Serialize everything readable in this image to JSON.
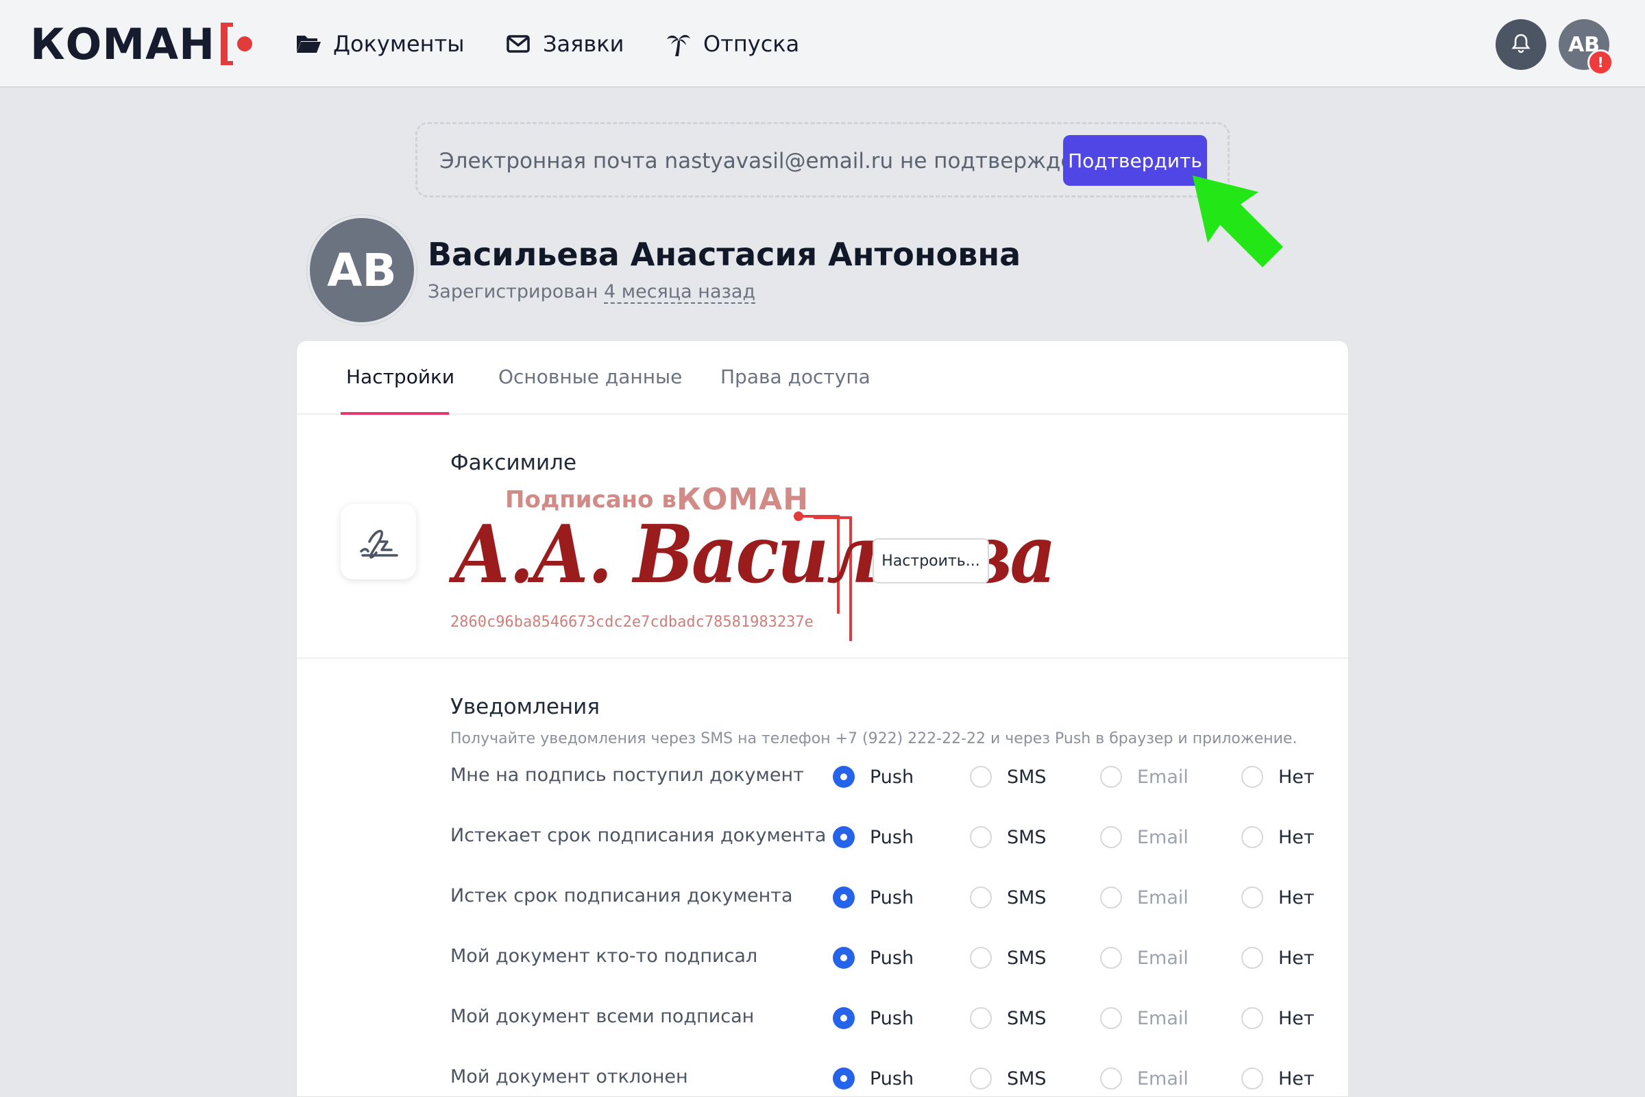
{
  "header": {
    "logo": "КОМАН",
    "nav": [
      {
        "label": "Документы",
        "icon": "folder-open-icon"
      },
      {
        "label": "Заявки",
        "icon": "envelope-icon"
      },
      {
        "label": "Отпуска",
        "icon": "palm-tree-icon"
      }
    ],
    "user_initials": "АВ",
    "alert_badge": "!"
  },
  "email_notice": {
    "text": "Электронная почта nastyavasil@email.ru не подтверждена",
    "confirm_label": "Подтвердить"
  },
  "profile": {
    "initials": "АВ",
    "name": "Васильева Анастасия Антоновна",
    "registered_prefix": "Зарегистрирован",
    "registered_ago": "4 месяца назад"
  },
  "tabs": [
    {
      "label": "Настройки",
      "active": true
    },
    {
      "label": "Основные данные",
      "active": false
    },
    {
      "label": "Права доступа",
      "active": false
    }
  ],
  "facsimile": {
    "title": "Факсимиле",
    "caption": "Подписано в",
    "brand": "КОМАН",
    "signature": "А.А. Васильева",
    "hash": "2860c96ba8546673cdc2e7cdbadc78581983237e",
    "configure_label": "Настроить..."
  },
  "notifications": {
    "title": "Уведомления",
    "description": "Получайте уведомления через SMS на телефон +7 (922) 222-22-22 и через Push в браузер и приложение.",
    "options": [
      "Push",
      "SMS",
      "Email",
      "Нет"
    ],
    "rows": [
      {
        "label": "Мне на подпись поступил документ",
        "selected": "Push"
      },
      {
        "label": "Истекает срок подписания документа",
        "selected": "Push"
      },
      {
        "label": "Истек срок подписания документа",
        "selected": "Push"
      },
      {
        "label": "Мой документ кто-то подписал",
        "selected": "Push"
      },
      {
        "label": "Мой документ всеми подписан",
        "selected": "Push"
      },
      {
        "label": "Мой документ отклонен",
        "selected": "Push"
      }
    ]
  },
  "colors": {
    "accent": "#4f46e5",
    "radio_selected": "#2563eb",
    "tab_underline": "#e5396e",
    "logo_red": "#e23b3b",
    "signature": "#9b1c1c",
    "pointer": "#22e615"
  }
}
